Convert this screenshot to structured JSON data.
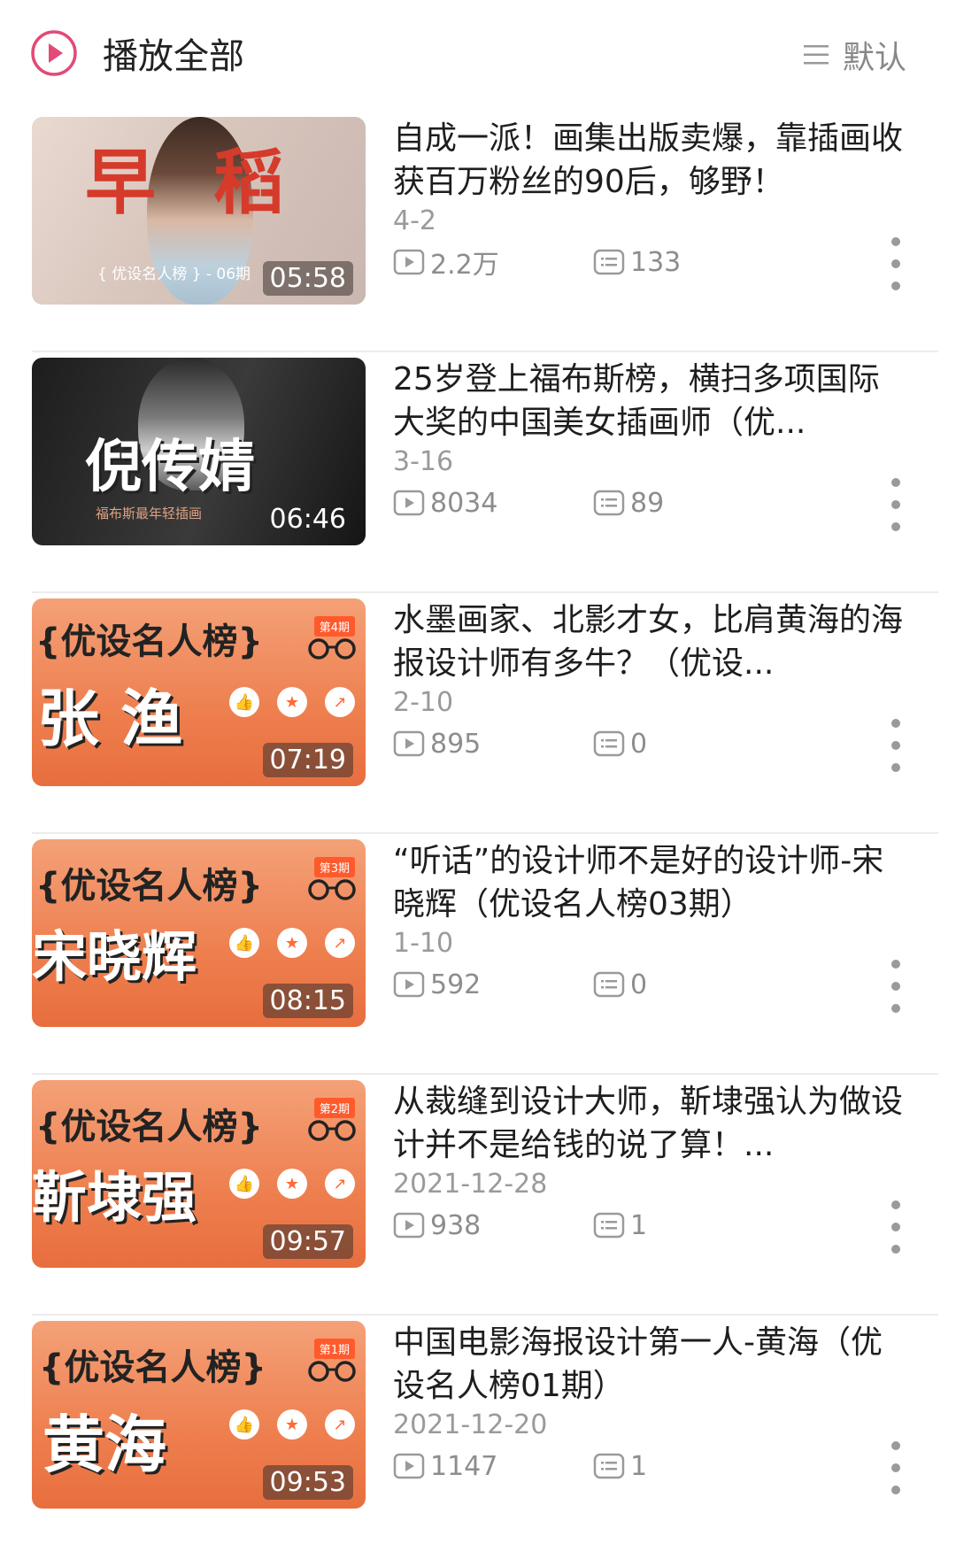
{
  "header": {
    "play_all_label": "播放全部",
    "sort_label": "默认",
    "accent": "#e24a77"
  },
  "videos": [
    {
      "title": "自成一派！画集出版卖爆，靠插画收获百万粉丝的90后，够野！",
      "date": "4-2",
      "views": "2.2万",
      "comments": "133",
      "duration": "05:58",
      "thumb": {
        "style": "photo-light",
        "chars": [
          "早",
          "稻"
        ],
        "caption": "{ 优设名人榜 } - 06期"
      }
    },
    {
      "title": "25岁登上福布斯榜，横扫多项国际大奖的中国美女插画师（优...",
      "date": "3-16",
      "views": "8034",
      "comments": "89",
      "duration": "06:46",
      "thumb": {
        "style": "photo-dark",
        "name": "倪传婧",
        "caption": "福布斯最年轻插画"
      }
    },
    {
      "title": "水墨画家、北影才女，比肩黄海的海报设计师有多牛？（优设...",
      "date": "2-10",
      "views": "895",
      "comments": "0",
      "duration": "07:19",
      "thumb": {
        "style": "orange",
        "tag": "{优设名人榜}",
        "issue": "第4期",
        "name": "张 渔"
      }
    },
    {
      "title": "“听话”的设计师不是好的设计师-宋晓辉（优设名人榜03期）",
      "date": "1-10",
      "views": "592",
      "comments": "0",
      "duration": "08:15",
      "thumb": {
        "style": "orange",
        "tag": "{优设名人榜}",
        "issue": "第3期",
        "name": "宋晓辉"
      }
    },
    {
      "title": "从裁缝到设计大师，靳埭强认为做设计并不是给钱的说了算！...",
      "date": "2021-12-28",
      "views": "938",
      "comments": "1",
      "duration": "09:57",
      "thumb": {
        "style": "orange",
        "tag": "{优设名人榜}",
        "issue": "第2期",
        "name": "靳埭强"
      }
    },
    {
      "title": "中国电影海报设计第一人-黄海（优设名人榜01期）",
      "date": "2021-12-20",
      "views": "1147",
      "comments": "1",
      "duration": "09:53",
      "thumb": {
        "style": "orange",
        "tag": "{优设名人榜}",
        "issue": "第1期",
        "name": "黄海"
      }
    }
  ]
}
